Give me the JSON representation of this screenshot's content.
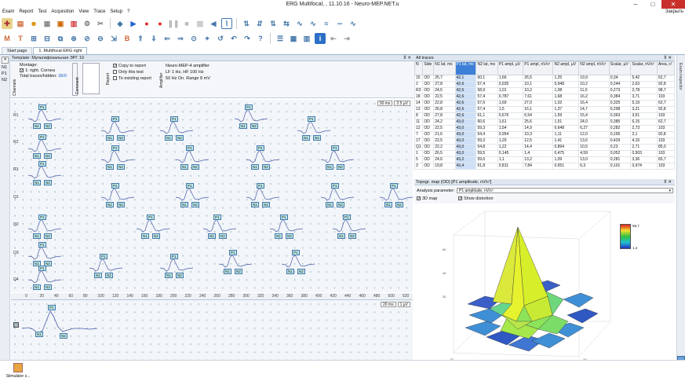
{
  "window": {
    "title": "ERG Multifocal, , 11.10.16 - Neuro-MEP.NET.u",
    "close_label": "Закрыть"
  },
  "menu": [
    "Exam",
    "Report",
    "Test",
    "Acquisition",
    "View",
    "Trace",
    "Setup",
    "?"
  ],
  "tabs": [
    "Start page",
    "1. Multifocal ERG right"
  ],
  "left_strip": {
    "close": "✕",
    "items": [
      "N1",
      "P1",
      "N2"
    ]
  },
  "template_bar": "Template: Мультифокальная ЭРГ 19",
  "controls": {
    "channels_label": "Channels",
    "montage_label": "Montage:",
    "montage_item": "1: right. Cornea",
    "total_label": "Total traces/hidden:",
    "total_value": "38/0",
    "comment_label": "Comment",
    "report_label": "Report",
    "copy_to_report": "Copy to report",
    "only_this_test": "Only this test",
    "to_existing_report": "To existing report",
    "amplifier_label": "Amplifier",
    "amp_name": "Neuro-MEP-4 amplifier",
    "amp_filter": "LF  1 Hz, HF  100 Hz",
    "amp_notch": "50 Hz  On. Range 8 mV"
  },
  "grid": {
    "time_sel": "50 ms",
    "amp_sel": "2.5 µV",
    "row_labels": [
      "R1",
      "R2",
      "R3",
      "Q1",
      "Q2",
      "Q3",
      "Q4"
    ]
  },
  "ruler": [
    "0",
    "20",
    "40",
    "60",
    "80",
    "100",
    "120",
    "140",
    "160",
    "180",
    "200",
    "220",
    "240",
    "260",
    "280",
    "300",
    "320",
    "340",
    "360",
    "380",
    "400",
    "420",
    "440",
    "460",
    "480",
    "500",
    "520",
    "540"
  ],
  "wave": {
    "time_sel": "20 ms",
    "amp_sel": "1 µV"
  },
  "traces_panel": {
    "title": "All traces",
    "headers": [
      "N",
      "Side",
      "N1 lat, ms",
      "P1 lat, ms",
      "N2 lat, ms",
      "P1 ampl, µV",
      "P1 ampl, nV/c²",
      "N2 ampl, µV",
      "N2 ampl, nV/c²",
      "Scalar, µV",
      "Scalar, nV/c²",
      "Area, c²"
    ],
    "rows": [
      [
        "15",
        "OD",
        "25,7",
        "42,1",
        "60,1",
        "1,66",
        "26,5",
        "1,25",
        "19,9",
        "0,34",
        "5,42",
        "62,7"
      ],
      [
        "2",
        "OD",
        "27,8",
        "42,6",
        "57,4",
        "0,935",
        "10,1",
        "0,948",
        "10,2",
        "0,244",
        "2,63",
        "92,8"
      ],
      [
        "R3",
        "OD",
        "24,5",
        "42,6",
        "58,9",
        "1,01",
        "10,2",
        "1,08",
        "11,0",
        "0,273",
        "2,78",
        "98,7"
      ],
      [
        "18",
        "OD",
        "22,5",
        "42,6",
        "57,4",
        "0,787",
        "7,61",
        "1,68",
        "16,2",
        "0,384",
        "3,71",
        "103"
      ],
      [
        "14",
        "OD",
        "22,8",
        "42,6",
        "57,6",
        "1,69",
        "27,0",
        "1,02",
        "16,4",
        "0,325",
        "5,19",
        "62,7"
      ],
      [
        "13",
        "OD",
        "26,8",
        "42,6",
        "57,4",
        "1,5",
        "16,1",
        "1,37",
        "14,7",
        "0,298",
        "3,21",
        "92,8"
      ],
      [
        "8",
        "OD",
        "27,8",
        "42,6",
        "61,1",
        "0,676",
        "6,54",
        "1,59",
        "15,4",
        "0,363",
        "3,51",
        "103"
      ],
      [
        "11",
        "OD",
        "24,2",
        "43,0",
        "60,6",
        "1,61",
        "25,6",
        "1,51",
        "24,0",
        "0,385",
        "6,15",
        "62,7"
      ],
      [
        "12",
        "OD",
        "22,5",
        "43,0",
        "59,3",
        "1,54",
        "14,9",
        "0,648",
        "6,27",
        "0,282",
        "2,73",
        "103"
      ],
      [
        "7",
        "OD",
        "21,6",
        "43,0",
        "54,4",
        "0,954",
        "10,3",
        "1,11",
        "12,0",
        "0,195",
        "2,1",
        "92,8"
      ],
      [
        "17",
        "OD",
        "22,5",
        "43,0",
        "59,3",
        "1,29",
        "12,5",
        "1,41",
        "13,6",
        "0,429",
        "4,15",
        "103"
      ],
      [
        "Q1",
        "OD",
        "22,2",
        "43,0",
        "54,8",
        "1,22",
        "14,4",
        "0,894",
        "10,5",
        "0,23",
        "2,71",
        "85,0"
      ],
      [
        "1",
        "OD",
        "26,5",
        "43,0",
        "59,5",
        "0,145",
        "1,4",
        "0,475",
        "4,59",
        "0,052",
        "0,503",
        "103"
      ],
      [
        "5",
        "OD",
        "24,6",
        "43,2",
        "59,6",
        "1,1",
        "13,2",
        "1,09",
        "13,0",
        "0,281",
        "3,36",
        "83,7"
      ],
      [
        "3",
        "OD",
        "19,8",
        "43,4",
        "51,8",
        "0,811",
        "7,84",
        "0,651",
        "6,3",
        "0,101",
        "0,974",
        "103"
      ]
    ]
  },
  "topo_panel": {
    "title": "Topogr. map (OD) [P1 amplitude, nV/c²]",
    "param_label": "Analysis parameter:",
    "param_value": "P1 amplitude, nV/c²",
    "map3d": "3D map",
    "distortion": "Show distortion",
    "scale_max": "59,7",
    "scale_min": "1,4"
  },
  "right_strip": "Exam inspector",
  "status": {
    "stimulator": "Stimulator s..."
  },
  "colors": {
    "accent": "#3d7fd6",
    "grid_bg": "#f2f5f9",
    "marker": "#bde9e9"
  }
}
